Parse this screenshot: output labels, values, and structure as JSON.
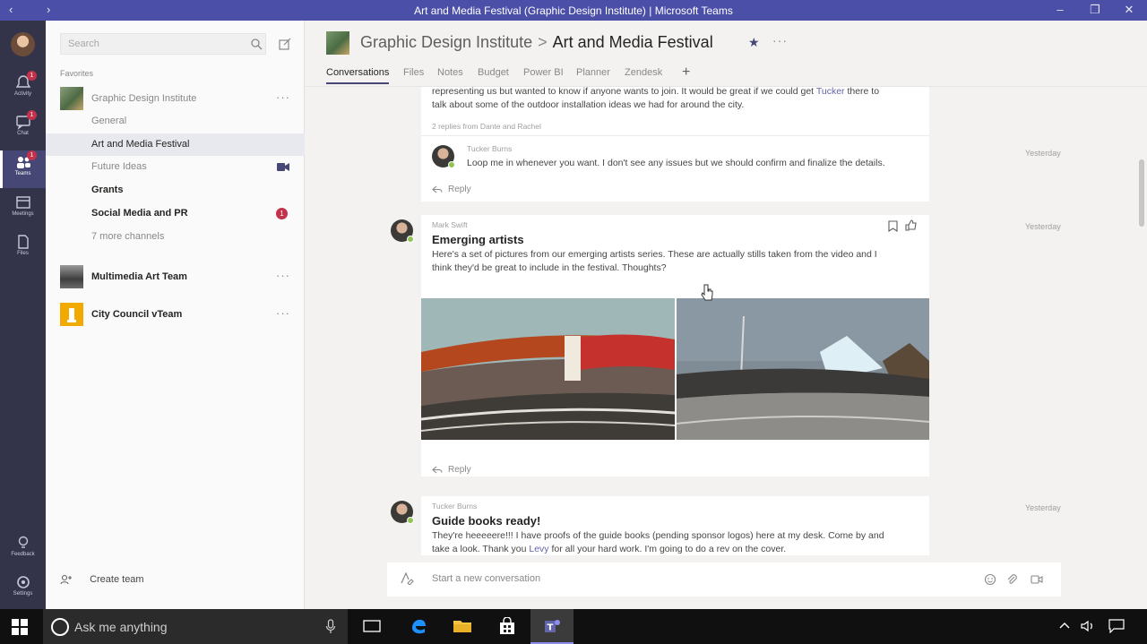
{
  "window": {
    "title": "Art and Media Festival (Graphic Design Institute) | Microsoft Teams"
  },
  "rail": {
    "items": [
      {
        "label": "Activity",
        "badge": "1"
      },
      {
        "label": "Chat",
        "badge": "1"
      },
      {
        "label": "Teams",
        "badge": "1"
      },
      {
        "label": "Meetings"
      },
      {
        "label": "Files"
      },
      {
        "label": "Feedback"
      },
      {
        "label": "Settings"
      }
    ]
  },
  "sidebar": {
    "search_placeholder": "Search",
    "favorites_label": "Favorites",
    "teams": [
      {
        "name": "Graphic Design Institute"
      },
      {
        "name": "Multimedia Art Team"
      },
      {
        "name": "City Council vTeam"
      }
    ],
    "channels": [
      {
        "name": "General"
      },
      {
        "name": "Art and Media Festival"
      },
      {
        "name": "Future Ideas"
      },
      {
        "name": "Grants"
      },
      {
        "name": "Social Media and PR",
        "badge": "1"
      },
      {
        "name": "7 more channels"
      }
    ],
    "create_team": "Create team"
  },
  "header": {
    "team": "Graphic Design Institute",
    "separator": ">",
    "channel": "Art and Media Festival",
    "more": "···",
    "tabs": [
      "Conversations",
      "Files",
      "Notes",
      "Budget",
      "Power BI",
      "Planner",
      "Zendesk"
    ],
    "add_tab": "+"
  },
  "feed": {
    "msg1": {
      "text_a": "representing us but wanted to know if anyone wants to join. It would be great if we could get ",
      "mention": "Tucker",
      "text_b": " there to",
      "text_c": "talk about some of the outdoor installation ideas we had for around the city.",
      "replies_summary": "2 replies from Dante and Rachel",
      "reply_author": "Tucker Burns",
      "reply_text": "Loop me in whenever you want. I don't see any issues but we should confirm and finalize the details.",
      "reply_time": "Yesterday",
      "reply_label": "Reply"
    },
    "msg2": {
      "author": "Mark Swift",
      "subject": "Emerging artists",
      "text_a": "Here's a set of pictures from our emerging artists series. These are actually stills taken from the video and I",
      "text_b": "think they'd be great to include in the festival. Thoughts?",
      "time": "Yesterday",
      "reply_label": "Reply"
    },
    "msg3": {
      "author": "Tucker Burns",
      "subject": "Guide books ready!",
      "text_a": "They're heeeeere!!! I have proofs of the guide books (pending sponsor logos) here at my desk. Come by and",
      "text_b_pre": "take a look. Thank you ",
      "mention": "Levy",
      "text_b_post": " for all your hard work. I'm going to do a rev on the cover.",
      "time": "Yesterday"
    }
  },
  "composer": {
    "placeholder": "Start a new conversation"
  },
  "taskbar": {
    "search_text": "Ask me anything"
  },
  "colors": {
    "accent": "#464775",
    "rail": "#33344a",
    "titlebar": "#4b4fa8",
    "badge": "#c4314b",
    "presence": "#92c353"
  }
}
